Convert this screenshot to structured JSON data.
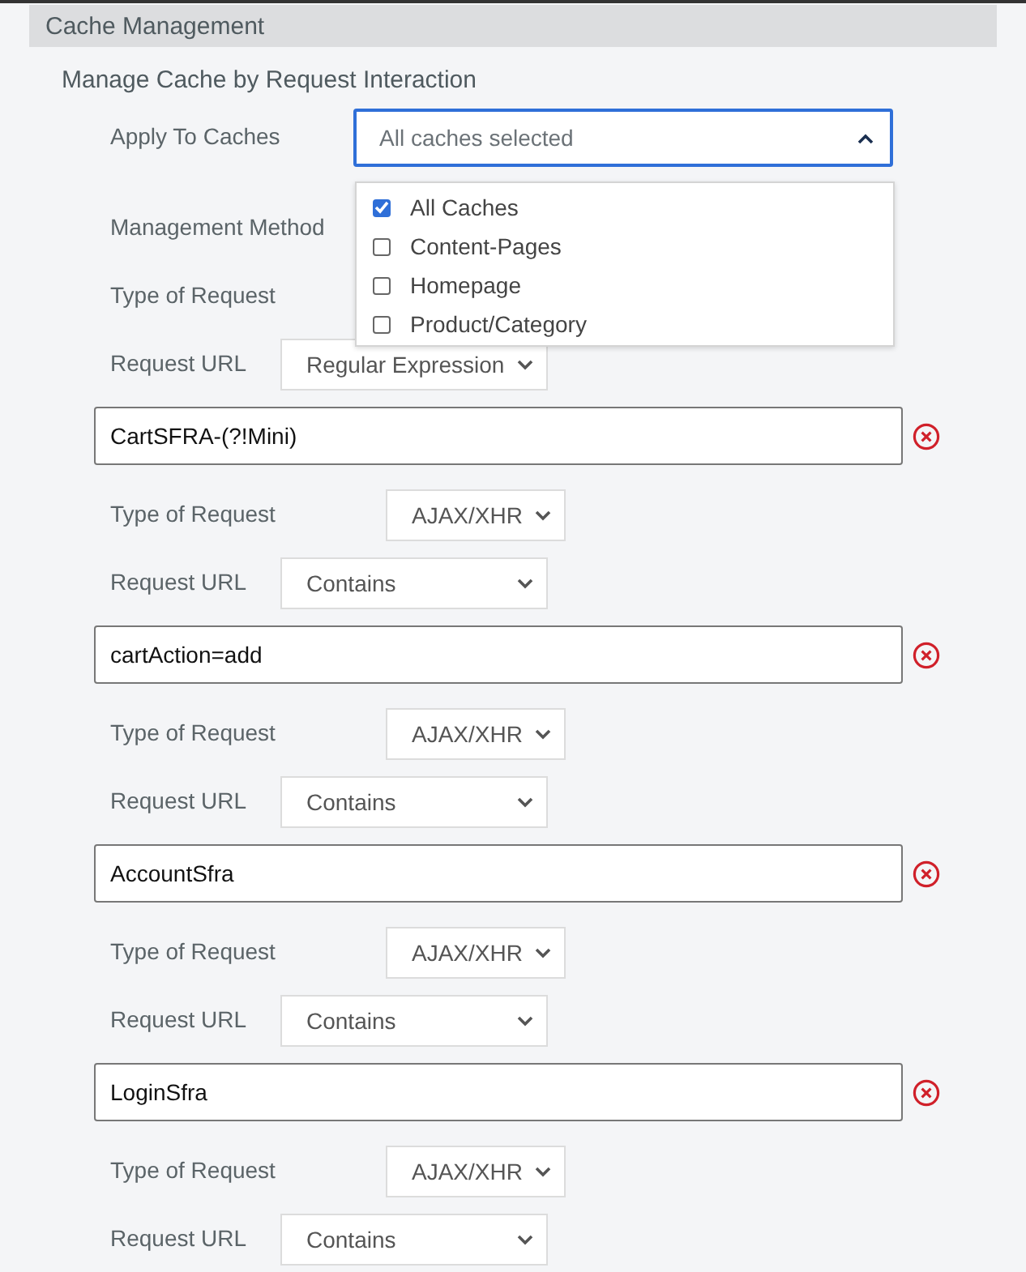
{
  "section_title": "Cache Management",
  "subtitle": "Manage Cache by Request Interaction",
  "apply": {
    "label": "Apply To Caches",
    "placeholder": "All caches selected",
    "expanded": true,
    "options": [
      {
        "label": "All Caches",
        "checked": true
      },
      {
        "label": "Content-Pages",
        "checked": false
      },
      {
        "label": "Homepage",
        "checked": false
      },
      {
        "label": "Product/Category",
        "checked": false
      }
    ]
  },
  "rows": [
    {
      "kind": "type",
      "label": "Management Method"
    },
    {
      "kind": "type",
      "label": "Type of Request"
    },
    {
      "kind": "url",
      "label": "Request URL",
      "value": "Regular Expression"
    },
    {
      "kind": "pattern",
      "value": "CartSFRA-(?!Mini)"
    },
    {
      "kind": "type",
      "label": "Type of Request",
      "value": "AJAX/XHR"
    },
    {
      "kind": "url",
      "label": "Request URL",
      "value": "Contains"
    },
    {
      "kind": "pattern",
      "value": "cartAction=add"
    },
    {
      "kind": "type",
      "label": "Type of Request",
      "value": "AJAX/XHR"
    },
    {
      "kind": "url",
      "label": "Request URL",
      "value": "Contains"
    },
    {
      "kind": "pattern",
      "value": "AccountSfra"
    },
    {
      "kind": "type",
      "label": "Type of Request",
      "value": "AJAX/XHR"
    },
    {
      "kind": "url",
      "label": "Request URL",
      "value": "Contains"
    },
    {
      "kind": "pattern",
      "value": "LoginSfra"
    },
    {
      "kind": "type",
      "label": "Type of Request",
      "value": "AJAX/XHR"
    },
    {
      "kind": "url",
      "label": "Request URL",
      "value": "Contains"
    }
  ]
}
